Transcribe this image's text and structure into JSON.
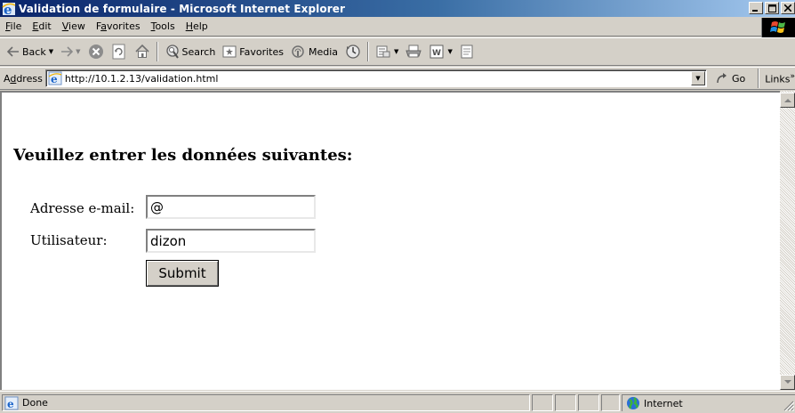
{
  "window": {
    "title": "Validation de formulaire - Microsoft Internet Explorer",
    "minimize": "_",
    "restore": "□",
    "close": "✕"
  },
  "menu": {
    "items": [
      {
        "first": "F",
        "rest": "ile"
      },
      {
        "first": "E",
        "rest": "dit"
      },
      {
        "first": "V",
        "rest": "iew"
      },
      {
        "first": "F",
        "pre": "",
        "rest": "avorites",
        "underlineIndex": 1
      },
      {
        "first": "T",
        "rest": "ools"
      },
      {
        "first": "H",
        "rest": "elp"
      }
    ],
    "labels": [
      "File",
      "Edit",
      "View",
      "Favorites",
      "Tools",
      "Help"
    ]
  },
  "toolbar": {
    "back": "Back",
    "search": "Search",
    "favorites": "Favorites",
    "media": "Media"
  },
  "address": {
    "label": "Address",
    "url": "http://10.1.2.13/validation.html",
    "go": "Go",
    "links": "Links"
  },
  "page": {
    "heading": "Veuillez entrer les données suivantes:",
    "email_label": "Adresse e-mail:",
    "email_value": "@",
    "user_label": "Utilisateur:",
    "user_value": "dizon",
    "submit": "Submit"
  },
  "status": {
    "text": "Done",
    "zone": "Internet"
  },
  "colors": {
    "title_start": "#0a246a",
    "title_end": "#a6caf0",
    "chrome": "#d4d0c8"
  }
}
